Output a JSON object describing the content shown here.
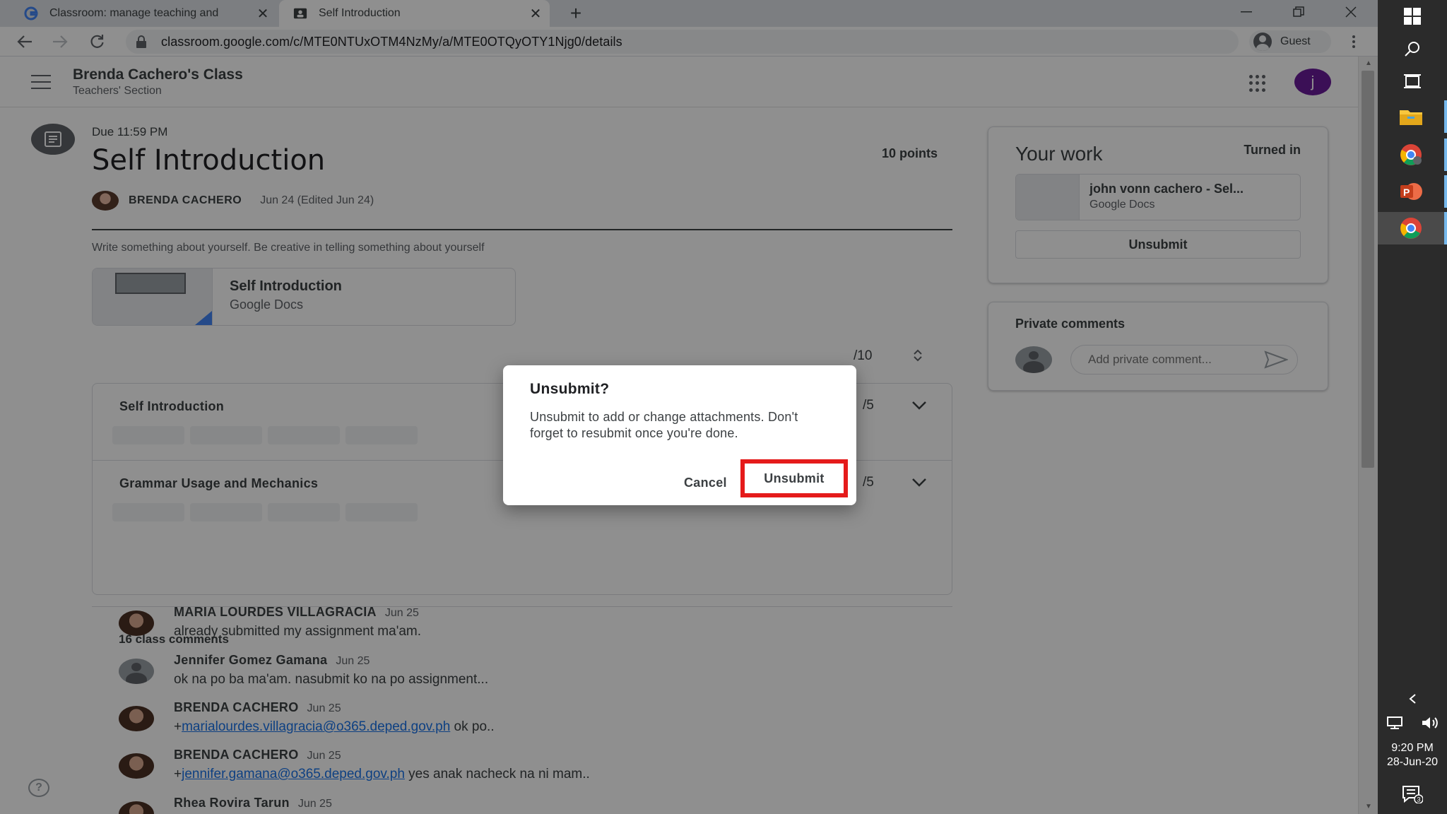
{
  "browser": {
    "tabs": [
      {
        "title": "Classroom: manage teaching and",
        "favicon": "google-g-icon",
        "active": false
      },
      {
        "title": "Self Introduction",
        "favicon": "classroom-icon",
        "active": true
      }
    ],
    "url": "classroom.google.com/c/MTE0NTUxOTM4NzMy/a/MTE0OTQyOTY1Njg0/details",
    "profile_label": "Guest"
  },
  "appbar": {
    "class_name": "Brenda Cachero's Class",
    "section": "Teachers' Section",
    "avatar_letter": "j",
    "avatar_color": "#6a1b9a"
  },
  "assignment": {
    "due": "Due 11:59 PM",
    "title": "Self Introduction",
    "points": "10 points",
    "author": "BRENDA CACHERO",
    "date": "Jun 24 (Edited Jun 24)",
    "description": "Write  something about yourself. Be creative in telling something about yourself",
    "attachment": {
      "title": "Self Introduction",
      "type": "Google Docs"
    },
    "grade_total": "/10"
  },
  "rubric": [
    {
      "title": "Self Introduction",
      "score": "/5"
    },
    {
      "title": "Grammar Usage and Mechanics",
      "score": "/5"
    }
  ],
  "comments": {
    "count_label": "16 class comments",
    "items": [
      {
        "name": "MARIA LOURDES VILLAGRACIA",
        "date": "Jun 25",
        "text": "already submitted my assignment ma'am.",
        "avatar": "person"
      },
      {
        "name": "Jennifer Gomez Gamana",
        "date": "Jun 25",
        "text": "ok na po ba ma'am. nasubmit ko na po assignment...",
        "avatar": "generic"
      },
      {
        "name": "BRENDA CACHERO",
        "date": "Jun 25",
        "prefix": "+",
        "link": "marialourdes.villagracia@o365.deped.gov.ph",
        "text": " ok po..",
        "avatar": "person"
      },
      {
        "name": "BRENDA CACHERO",
        "date": "Jun 25",
        "prefix": "+",
        "link": "jennifer.gamana@o365.deped.gov.ph",
        "text": " yes anak nacheck na ni mam..",
        "avatar": "person"
      },
      {
        "name": "Rhea Rovira Tarun",
        "date": "Jun 25",
        "text": "",
        "avatar": "person"
      }
    ]
  },
  "your_work": {
    "title": "Your work",
    "status": "Turned in",
    "file_name": "john vonn cachero - Sel...",
    "file_type": "Google Docs",
    "unsubmit_label": "Unsubmit"
  },
  "private_comments": {
    "title": "Private comments",
    "placeholder": "Add private comment..."
  },
  "dialog": {
    "title": "Unsubmit?",
    "body": "Unsubmit to add or change attachments. Don't forget to resubmit once you're done.",
    "cancel_label": "Cancel",
    "confirm_label": "Unsubmit",
    "highlight_color": "#e51b1b"
  },
  "taskbar": {
    "time": "9:20 PM",
    "date": "28-Jun-20",
    "notification_count": "3"
  }
}
